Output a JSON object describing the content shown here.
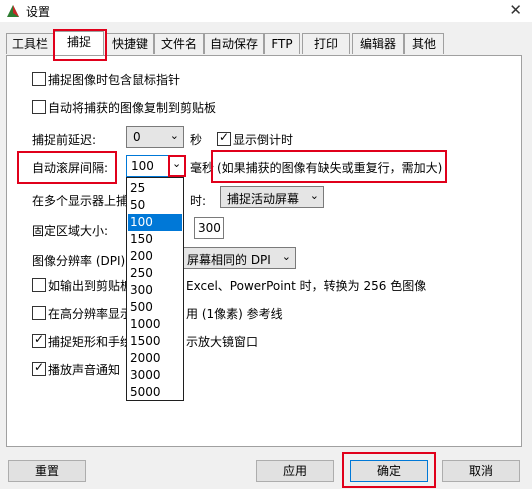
{
  "window": {
    "title": "设置",
    "close": "✕"
  },
  "tabs": [
    "工具栏",
    "捕捉",
    "快捷键",
    "文件名",
    "自动保存",
    "FTP",
    "打印",
    "编辑器",
    "其他"
  ],
  "options": {
    "include_cursor": "捕捉图像时包含鼠标指针",
    "copy_clipboard": "自动将捕获的图像复制到剪贴板",
    "delay_label": "捕捉前延迟:",
    "delay_value": "0",
    "delay_unit": "秒",
    "show_countdown": "显示倒计时",
    "scroll_interval_label": "自动滚屏间隔:",
    "scroll_interval_value": "100",
    "scroll_unit": "毫秒",
    "scroll_hint": "(如果捕获的图像有缺失或重复行，需加大)",
    "multi_monitor_label": "在多个显示器上捕",
    "multi_monitor_label2": "时:",
    "multi_monitor_value": "捕捉活动屏幕",
    "fixed_region_label": "固定区域大小:",
    "fixed_region_value": "300",
    "dpi_label": "图像分辨率 (DPI)",
    "dpi_value": "屏幕相同的 DPI",
    "clipboard_excel_pre": "如输出到剪贴板",
    "clipboard_excel_post": "Excel、PowerPoint 时，转换为 256 色图像",
    "high_dpi_pre": "在高分辨率显示",
    "high_dpi_post": "用 (1像素) 参考线",
    "magnifier_pre": "捕捉矩形和手绘",
    "magnifier_post": "示放大镜窗口",
    "sound": "播放声音通知"
  },
  "dropdown_options": [
    "25",
    "50",
    "100",
    "150",
    "200",
    "250",
    "300",
    "500",
    "1000",
    "1500",
    "2000",
    "3000",
    "5000"
  ],
  "dropdown_selected": "100",
  "buttons": {
    "reset": "重置",
    "apply": "应用",
    "ok": "确定",
    "cancel": "取消"
  }
}
